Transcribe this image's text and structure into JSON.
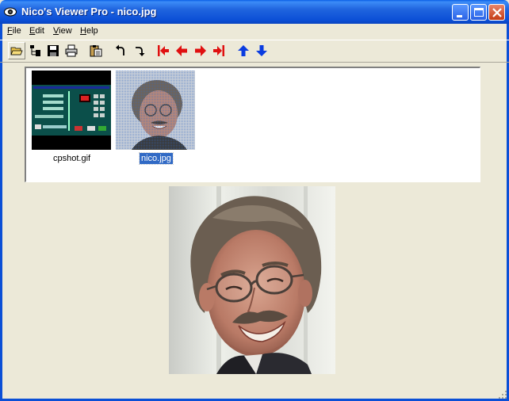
{
  "window": {
    "title": "Nico's Viewer Pro - nico.jpg",
    "controls": [
      "minimize",
      "maximize",
      "close"
    ]
  },
  "menu": {
    "items": [
      {
        "label_first": "F",
        "label_rest": "ile"
      },
      {
        "label_first": "E",
        "label_rest": "dit"
      },
      {
        "label_first": "V",
        "label_rest": "iew"
      },
      {
        "label_first": "H",
        "label_rest": "elp"
      }
    ]
  },
  "toolbar": {
    "buttons": [
      {
        "name": "open-folder-icon"
      },
      {
        "name": "tree-view-icon"
      },
      {
        "name": "save-icon"
      },
      {
        "name": "print-icon"
      },
      {
        "name": "paste-icon"
      },
      {
        "name": "rotate-left-icon"
      },
      {
        "name": "rotate-right-icon"
      },
      {
        "name": "first-image-icon"
      },
      {
        "name": "previous-image-icon"
      },
      {
        "name": "next-image-icon"
      },
      {
        "name": "last-image-icon"
      },
      {
        "name": "arrow-up-icon"
      },
      {
        "name": "arrow-down-icon"
      }
    ]
  },
  "thumbnails": [
    {
      "filename": "cpshot.gif",
      "selected": false
    },
    {
      "filename": "nico.jpg",
      "selected": true
    }
  ],
  "colors": {
    "titlebar": "#0b4fd6",
    "selection": "#316ac5",
    "window_bg": "#ece9d8",
    "nav_red": "#e01010",
    "nav_blue": "#0a3ce0"
  }
}
